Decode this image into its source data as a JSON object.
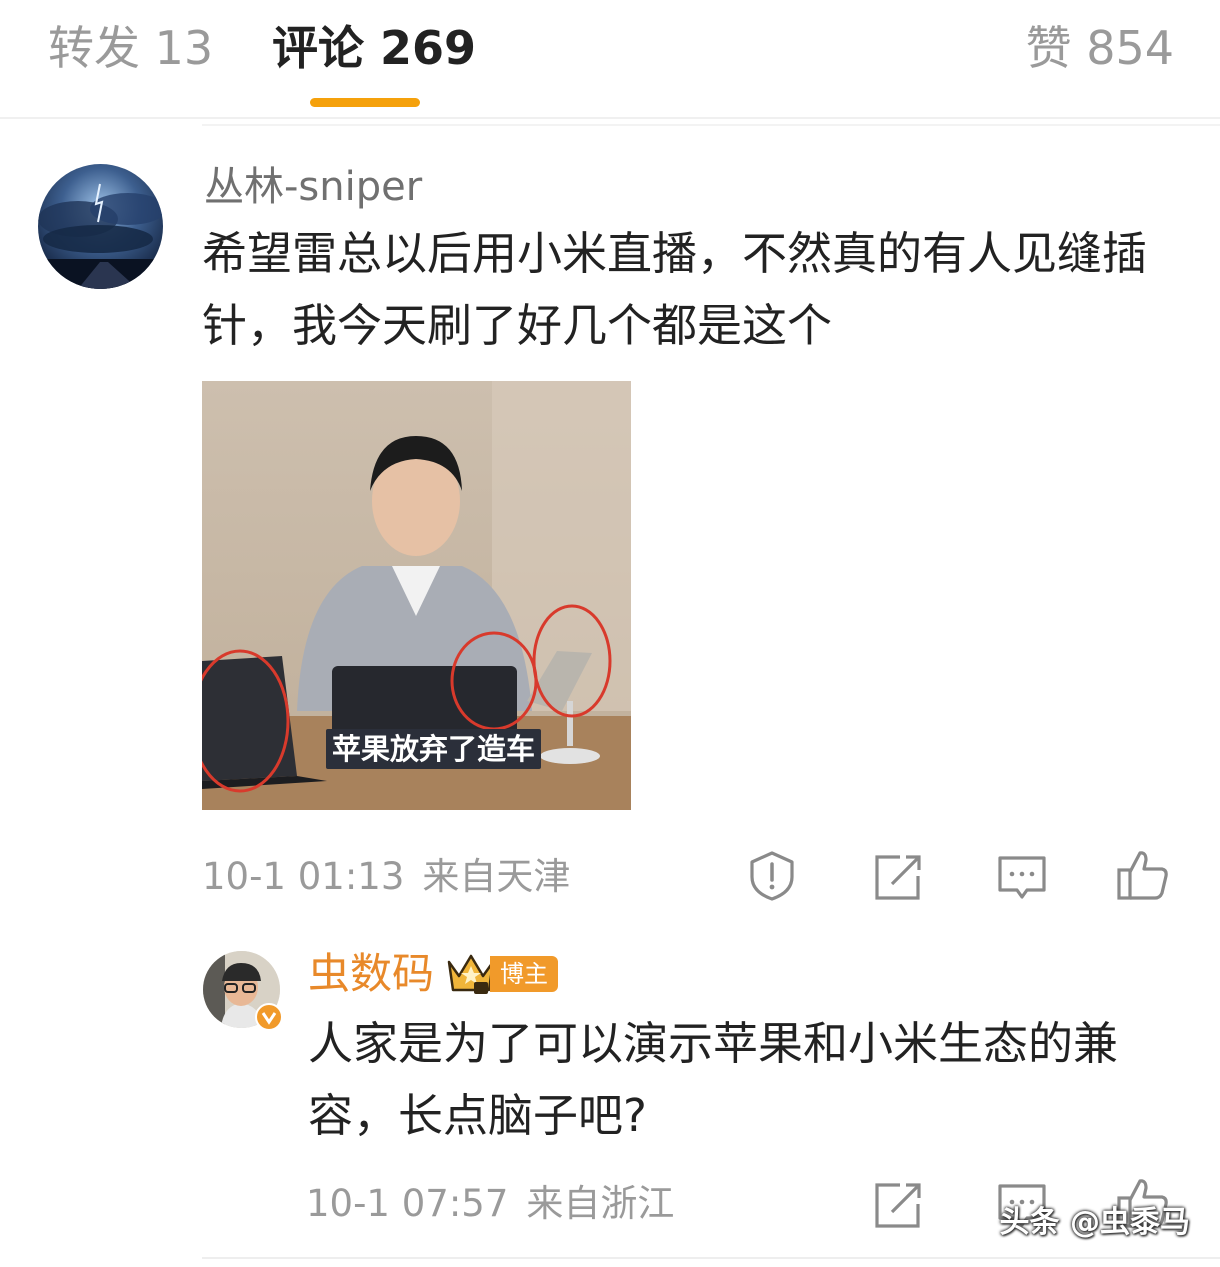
{
  "tabs": {
    "reposts": "转发 13",
    "comments": "评论 269",
    "likes": "赞 854"
  },
  "comments": [
    {
      "username": "丛林-sniper",
      "text": "希望雷总以后用小米直播，不然真的有人见缝插针，我今天刷了好几个都是这个",
      "image_caption": "苹果放弃了造车",
      "time": "10-1 01:13",
      "location": "来自天津"
    }
  ],
  "reply": {
    "username": "虫数码",
    "badge": "博主",
    "text": "人家是为了可以演示苹果和小米生态的兼容，长点脑子吧?",
    "time": "10-1 07:57",
    "location": "来自浙江"
  },
  "watermark": "头条 @虫黍马",
  "colors": {
    "accent": "#f5a10c",
    "blogger_name": "#e8892a",
    "muted_text": "#9a9a9a",
    "badge": "#f19a2a"
  },
  "icons": [
    "report-icon",
    "repost-icon",
    "comment-icon",
    "like-icon",
    "vip-crown-icon",
    "verified-icon"
  ]
}
